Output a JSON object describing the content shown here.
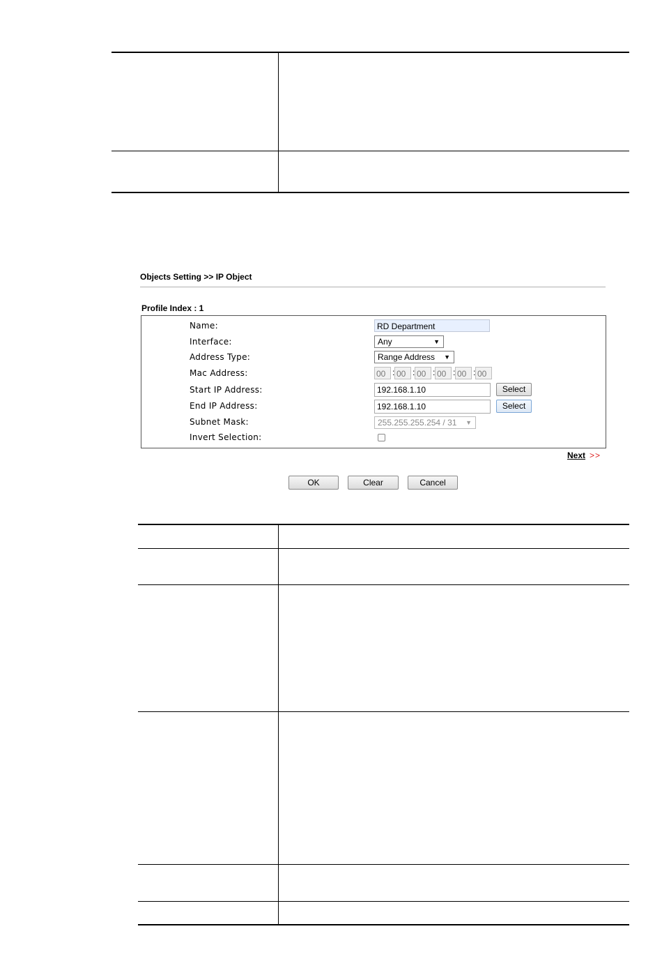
{
  "breadcrumb": "Objects Setting >> IP Object",
  "profile_index": "Profile Index : 1",
  "form": {
    "name_label": "Name:",
    "name_value": "RD Department",
    "interface_label": "Interface:",
    "interface_value": "Any",
    "address_type_label": "Address Type:",
    "address_type_value": "Range Address",
    "mac_label": "Mac Address:",
    "mac_octets": [
      "00",
      "00",
      "00",
      "00",
      "00",
      "00"
    ],
    "mac_separator": ":",
    "start_ip_label": "Start IP Address:",
    "start_ip_value": "192.168.1.10",
    "end_ip_label": "End IP Address:",
    "end_ip_value": "192.168.1.10",
    "subnet_label": "Subnet Mask:",
    "subnet_value": "255.255.255.254 / 31",
    "invert_label": "Invert Selection:",
    "invert_checked": false,
    "select_label": "Select"
  },
  "next_label": "Next",
  "next_arrows": ">>",
  "buttons": {
    "ok": "OK",
    "clear": "Clear",
    "cancel": "Cancel"
  },
  "icons": {
    "dropdown": "triangle-down-icon"
  }
}
